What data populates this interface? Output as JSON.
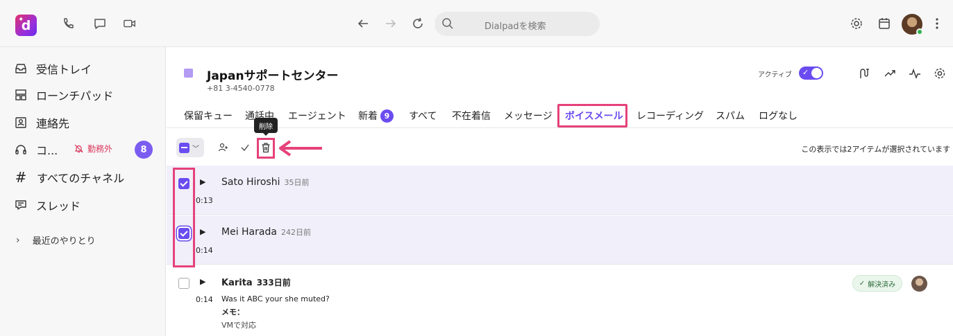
{
  "topbar": {
    "search_placeholder": "Dialpadを検索",
    "icons": [
      "phone-icon",
      "chat-icon",
      "video-icon",
      "back-arrow-icon",
      "forward-arrow-icon",
      "refresh-icon",
      "search-icon",
      "gear-icon",
      "calendar-icon",
      "more-icon"
    ]
  },
  "sidebar": {
    "items": [
      {
        "label": "受信トレイ",
        "icon": "inbox-icon"
      },
      {
        "label": "ローンチパッド",
        "icon": "launchpad-icon"
      },
      {
        "label": "連絡先",
        "icon": "contacts-icon"
      },
      {
        "label": "コ...",
        "icon": "headset-icon"
      },
      {
        "label": "すべてのチャネル",
        "icon": "hash-icon"
      },
      {
        "label": "スレッド",
        "icon": "threads-icon"
      }
    ],
    "offwork_label": "勤務外",
    "badge_count": "8",
    "recent_label": "最近のやりとり"
  },
  "header": {
    "title": "Japanサポートセンター",
    "phone": "+81 3-4540-0778",
    "active_label": "アクティブ",
    "accent": "#6a4cf0"
  },
  "tabs": [
    {
      "label": "保留キュー"
    },
    {
      "label": "通話中"
    },
    {
      "label": "エージェント"
    },
    {
      "label": "新着",
      "badge": "9"
    },
    {
      "label": "すべて"
    },
    {
      "label": "不在着信"
    },
    {
      "label": "メッセージ"
    },
    {
      "label": "ボイスメール",
      "active": true
    },
    {
      "label": "レコーディング"
    },
    {
      "label": "スパム"
    },
    {
      "label": "ログなし"
    }
  ],
  "toolbar": {
    "tooltip": "削除",
    "selection_text": "この表示では2アイテムが選択されています"
  },
  "voicemails": [
    {
      "caller": "Sato Hiroshi",
      "ago": "35日前",
      "duration": "0:13",
      "selected": true
    },
    {
      "caller": "Mei Harada",
      "ago": "242日前",
      "duration": "0:14",
      "selected": true
    },
    {
      "caller": "Karita",
      "ago": "333日前",
      "duration": "0:14",
      "selected": false,
      "message": "Was it ABC your she muted?",
      "memo_label": "メモ：",
      "memo": "VMで対応",
      "status": "解決済み"
    }
  ],
  "highlight_color": "#e5417a"
}
